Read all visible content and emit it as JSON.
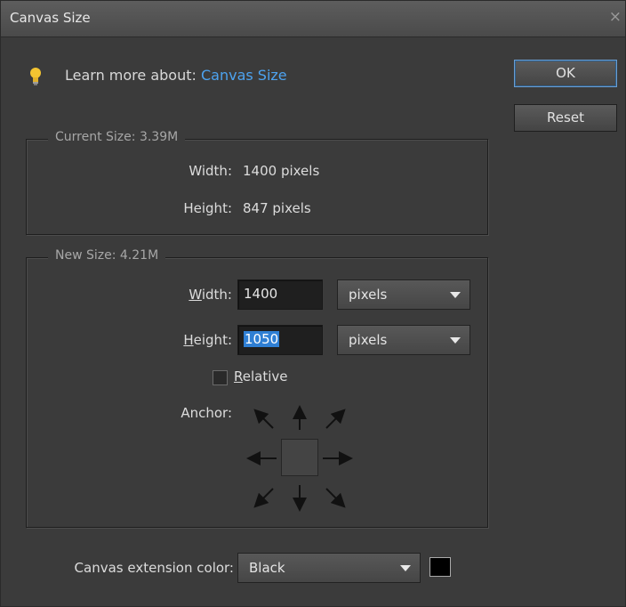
{
  "dialog": {
    "title": "Canvas Size",
    "close_glyph": "×"
  },
  "learn": {
    "prefix": "Learn more about: ",
    "link": "Canvas Size",
    "icon": "lightbulb-icon"
  },
  "buttons": {
    "ok": "OK",
    "reset": "Reset"
  },
  "current_size": {
    "legend": "Current Size: 3.39M",
    "width_label": "Width:",
    "width_value": "1400 pixels",
    "height_label": "Height:",
    "height_value": "847 pixels"
  },
  "new_size": {
    "legend": "New Size: 4.21M",
    "width_label_mnemonic": "W",
    "width_label_rest": "idth:",
    "width_value": "1400",
    "width_unit": "pixels",
    "height_label_mnemonic": "H",
    "height_label_rest": "eight:",
    "height_value": "1050",
    "height_unit": "pixels",
    "relative_mnemonic": "R",
    "relative_rest": "elative",
    "relative_checked": false,
    "anchor_label": "Anchor:"
  },
  "extension": {
    "label": "Canvas extension color:",
    "value": "Black",
    "swatch_color": "#000000"
  },
  "colors": {
    "accent": "#4da3f0",
    "selection": "#2f7fd4"
  }
}
